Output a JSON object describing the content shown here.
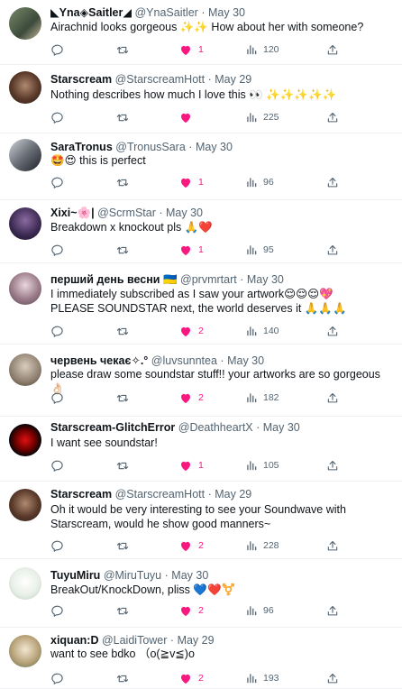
{
  "colors": {
    "like": "#f91880",
    "muted": "#536471",
    "text": "#0f1419",
    "divider": "#eff3f4"
  },
  "icons": {
    "reply": "reply-icon",
    "retweet": "retweet-icon",
    "like": "heart-icon",
    "views": "views-icon",
    "share": "share-icon"
  },
  "tweets": [
    {
      "name": "◣Yna◈Saitler◢",
      "handle": "@YnaSaitler",
      "time": "May 30",
      "text": "Airachnid looks gorgeous ✨✨ How about her with someone?",
      "likes": "1",
      "views": "120"
    },
    {
      "name": "Starscream",
      "handle": "@StarscreamHott",
      "time": "May 29",
      "text": "Nothing describes how much I love this 👀 ✨✨✨✨✨",
      "likes": "",
      "views": "225"
    },
    {
      "name": "SaraTronus",
      "handle": "@TronusSara",
      "time": "May 30",
      "text": "🤩😍 this is perfect",
      "likes": "1",
      "views": "96"
    },
    {
      "name": "Xixi~🌸|",
      "handle": "@ScrmStar",
      "time": "May 30",
      "text": "Breakdown x knockout pls 🙏❤️",
      "likes": "1",
      "views": "95"
    },
    {
      "name": "перший день весни 🇺🇦",
      "handle": "@prvmrtart",
      "time": "May 30",
      "text": "I immediately subscribed as I saw your artwork😌😌😌💖\nPLEASE SOUNDSTAR next, the world deserves it 🙏🙏🙏",
      "likes": "2",
      "views": "140"
    },
    {
      "name": "червень чекає✧.°",
      "handle": "@luvsunntea",
      "time": "May 30",
      "text": "please draw some soundstar stuff!! your artworks are so gorgeous👌🏻",
      "likes": "2",
      "views": "182"
    },
    {
      "name": "Starscream-GlitchError",
      "handle": "@DeathheartX",
      "time": "May 30",
      "text": "I want see soundstar!",
      "likes": "1",
      "views": "105"
    },
    {
      "name": "Starscream",
      "handle": "@StarscreamHott",
      "time": "May 29",
      "text": "Oh it would be very interesting to see your Soundwave with Starscream, would he show good manners~",
      "likes": "2",
      "views": "228"
    },
    {
      "name": "TuyuMiru",
      "handle": "@MiruTuyu",
      "time": "May 30",
      "text": "BreakOut/KnockDown, pliss 💙❤️⚧️",
      "likes": "2",
      "views": "96"
    },
    {
      "name": "xiquan:D",
      "handle": "@LaidiTower",
      "time": "May 29",
      "text": "want to see bdko （o(≧v≦)o",
      "likes": "2",
      "views": "193"
    }
  ]
}
